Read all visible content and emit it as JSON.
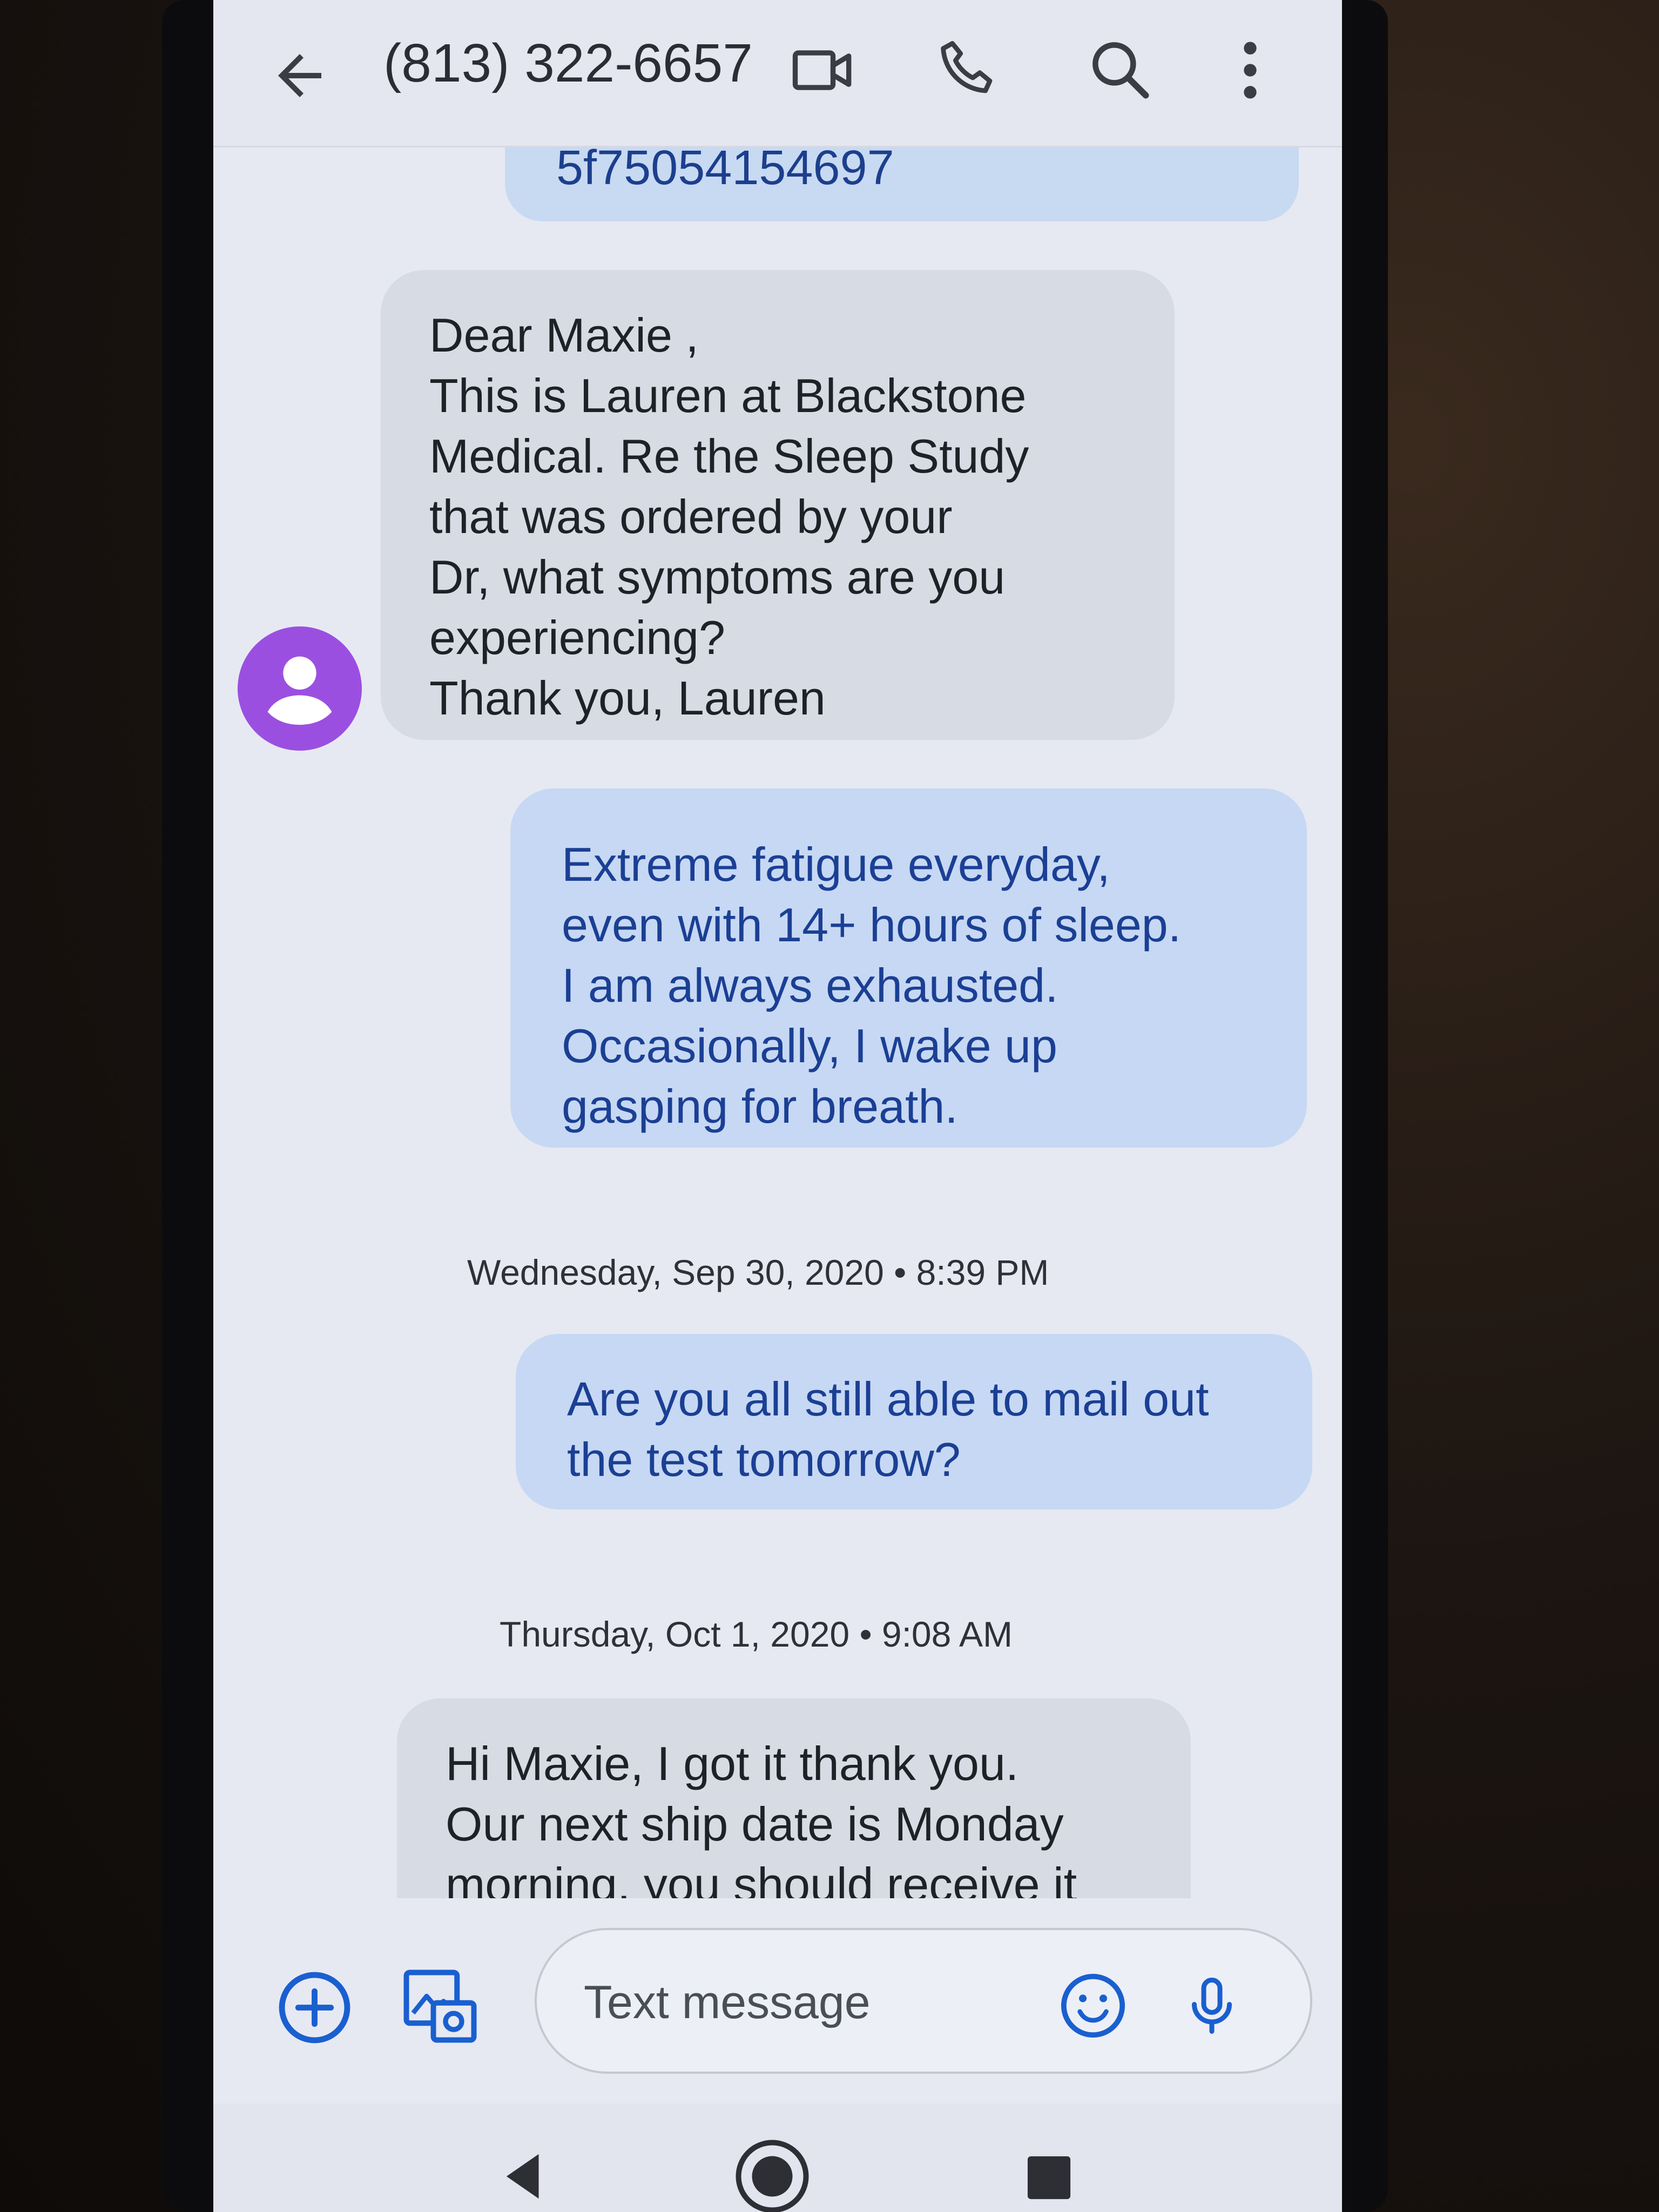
{
  "header": {
    "title": "(813) 322-6657",
    "icons": [
      "back-arrow-icon",
      "video-call-icon",
      "phone-call-icon",
      "search-icon",
      "more-options-icon"
    ]
  },
  "conversation": {
    "peek_text": "5f75054154697",
    "messages": [
      {
        "direction": "incoming",
        "text": "Dear Maxie ,\nThis is Lauren at Blackstone\nMedical. Re the Sleep Study\nthat was ordered by your\nDr, what symptoms are you\nexperiencing?\nThank you, Lauren"
      },
      {
        "direction": "outgoing",
        "text": "Extreme fatigue everyday,\neven with 14+ hours of sleep.\nI am always exhausted.\nOccasionally, I wake up\ngasping for breath."
      },
      {
        "direction": "outgoing",
        "text": "Are you all still able to mail out\nthe test tomorrow?"
      },
      {
        "direction": "incoming",
        "text": "Hi Maxie, I got it thank you.\nOur next ship date is Monday\nmorning, you should receive it"
      }
    ],
    "timestamps": [
      "Wednesday, Sep 30, 2020 • 8:39 PM",
      "Thursday, Oct 1, 2020 • 9:08 AM"
    ]
  },
  "composer": {
    "placeholder": "Text message",
    "icons": [
      "add-attachment-icon",
      "gallery-icon",
      "emoji-icon",
      "microphone-icon"
    ]
  },
  "colors": {
    "accent": "#1a5fd0",
    "incoming_bubble": "#d7dbe4",
    "outgoing_bubble": "#c6d8f3",
    "outgoing_text": "#1b3f94",
    "avatar": "#9b4fe0"
  }
}
